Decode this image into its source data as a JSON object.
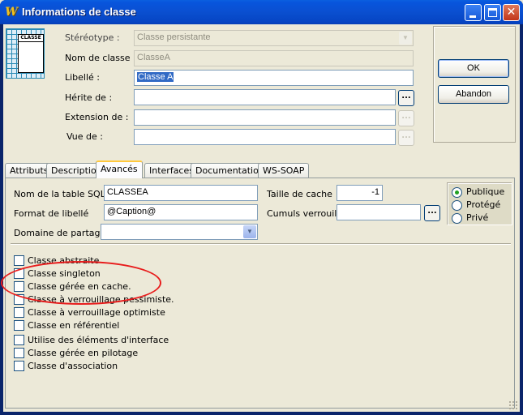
{
  "window": {
    "title": "Informations de classe",
    "app_icon_glyph": "W",
    "minimize_glyph": "",
    "close_glyph": "✕"
  },
  "header": {
    "class_icon_text": "CLASSE",
    "stereotype": {
      "label": "Stéréotype :",
      "value": "Classe persistante"
    },
    "class_name": {
      "label": "Nom de classe :",
      "value": "ClasseA"
    },
    "libelle": {
      "label": "Libellé :",
      "value": "Classe A"
    },
    "herite_de": {
      "label": "Hérite de :",
      "value": ""
    },
    "extension_de": {
      "label": "Extension de :",
      "value": ""
    },
    "vue_de": {
      "label": "Vue de :",
      "value": ""
    },
    "browse_glyph": "..."
  },
  "buttons": {
    "ok": "OK",
    "cancel": "Abandon"
  },
  "tabs": [
    {
      "label": "Attributs",
      "active": false
    },
    {
      "label": "Description",
      "active": false
    },
    {
      "label": "Avancés",
      "active": true
    },
    {
      "label": "Interfaces",
      "active": false
    },
    {
      "label": "Documentation",
      "active": false
    },
    {
      "label": "WS-SOAP",
      "active": false
    }
  ],
  "advanced": {
    "sql_table": {
      "label": "Nom de la table SQL",
      "value": "CLASSEA"
    },
    "label_format": {
      "label": "Format de libellé",
      "value": "@Caption@"
    },
    "sharing_domain": {
      "label": "Domaine de partage :",
      "value": ""
    },
    "cache_size": {
      "label": "Taille de cache",
      "value": "-1"
    },
    "locked_totals": {
      "label": "Cumuls verrouillé",
      "value": ""
    },
    "visibility": {
      "options": [
        "Publique",
        "Protégé",
        "Privé"
      ],
      "selected": "Publique"
    },
    "checkboxes": [
      {
        "label": "Classe abstraite",
        "checked": false
      },
      {
        "label": "Classe singleton",
        "checked": false
      },
      {
        "label": "Classe gérée en cache.",
        "checked": false
      },
      {
        "label": "Classe à verrouillage pessimiste.",
        "checked": false
      },
      {
        "label": "Classe à verrouillage optimiste",
        "checked": false
      },
      {
        "label": "Classe en référentiel",
        "checked": false
      },
      {
        "label": "Utilise des éléments d'interface",
        "checked": false
      },
      {
        "label": "Classe gérée en pilotage",
        "checked": false
      },
      {
        "label": "Classe d'association",
        "checked": false
      }
    ]
  },
  "colors": {
    "annotation_ellipse": "#e81c1c",
    "titlebar": "#0a4fd0",
    "selected_radio": "#21a121"
  }
}
